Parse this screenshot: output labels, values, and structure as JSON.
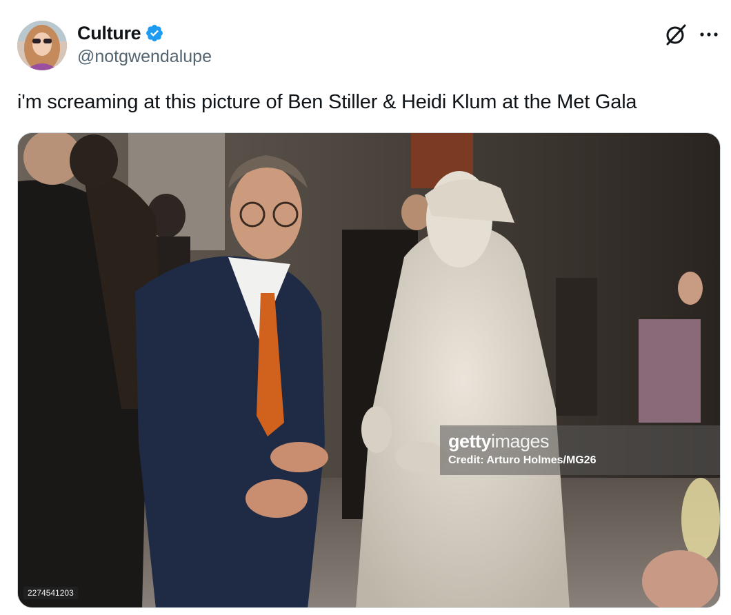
{
  "tweet": {
    "author": {
      "display_name": "Culture",
      "handle": "@notgwendalupe",
      "verified": true,
      "avatar_icon": "avatar-photo"
    },
    "text": "i'm screaming at this picture of Ben Stiller & Heidi Klum at the Met Gala",
    "actions": {
      "grok_icon": "grok-icon",
      "more_icon": "more-horizontal-icon"
    },
    "media": {
      "watermark_brand_bold": "getty",
      "watermark_brand_light": "images",
      "watermark_credit": "Credit: Arturo Holmes/MG26",
      "image_id": "2274541203"
    }
  },
  "colors": {
    "verified_blue": "#1d9bf0",
    "text_primary": "#0f1419",
    "text_secondary": "#536471",
    "border": "#cfd9de"
  }
}
